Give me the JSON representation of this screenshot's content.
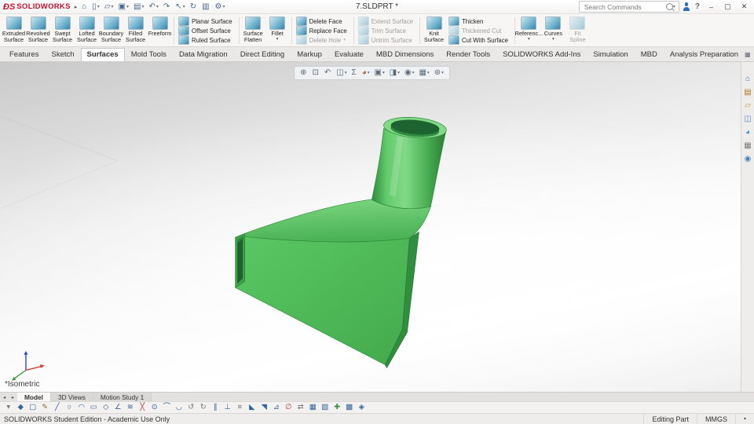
{
  "titlebar": {
    "brand_mark": "ÐS",
    "brand_name": "SOLIDWORKS",
    "flyout_glyph": "▸",
    "title": "7.SLDPRT *",
    "search_placeholder": "Search Commands",
    "help": "?",
    "quick_icons": [
      {
        "name": "home-button",
        "icon": "home-icon",
        "glyph": "⌂",
        "caret": ""
      },
      {
        "name": "new-document-button",
        "icon": "new-document-icon",
        "glyph": "▯",
        "caret": "▾"
      },
      {
        "name": "open-button",
        "icon": "open-folder-icon",
        "glyph": "▱",
        "caret": "▾"
      },
      {
        "name": "save-button",
        "icon": "save-icon",
        "glyph": "▣",
        "caret": "▾"
      },
      {
        "name": "print-button",
        "icon": "print-icon",
        "glyph": "▤",
        "caret": "▾"
      },
      {
        "name": "undo-button",
        "icon": "undo-icon",
        "glyph": "↶",
        "caret": "▾"
      },
      {
        "name": "redo-button",
        "icon": "redo-icon",
        "glyph": "↷",
        "caret": ""
      },
      {
        "name": "select-button",
        "icon": "select-arrow-icon",
        "glyph": "↖",
        "caret": "▾"
      },
      {
        "name": "rebuild-button",
        "icon": "rebuild-icon",
        "glyph": "↻",
        "caret": ""
      },
      {
        "name": "file-properties-button",
        "icon": "file-properties-icon",
        "glyph": "▥",
        "caret": ""
      },
      {
        "name": "options-button",
        "icon": "options-gear-icon",
        "glyph": "⚙",
        "caret": "▾"
      }
    ],
    "window_controls": {
      "minimize": "–",
      "maximize": "▢",
      "close": "✕"
    }
  },
  "ribbon": {
    "big_surface": [
      {
        "name": "extruded-surface-button",
        "icon": "extruded-surface-icon",
        "l1": "Extruded",
        "l2": "Surface",
        "caret": ""
      },
      {
        "name": "revolved-surface-button",
        "icon": "revolved-surface-icon",
        "l1": "Revolved",
        "l2": "Surface",
        "caret": ""
      },
      {
        "name": "swept-surface-button",
        "icon": "swept-surface-icon",
        "l1": "Swept",
        "l2": "Surface",
        "caret": ""
      },
      {
        "name": "lofted-surface-button",
        "icon": "lofted-surface-icon",
        "l1": "Lofted",
        "l2": "Surface",
        "caret": ""
      },
      {
        "name": "boundary-surface-button",
        "icon": "boundary-surface-icon",
        "l1": "Boundary",
        "l2": "Surface",
        "caret": ""
      },
      {
        "name": "filled-surface-button",
        "icon": "filled-surface-icon",
        "l1": "Filled",
        "l2": "Surface",
        "caret": ""
      },
      {
        "name": "freeform-button",
        "icon": "freeform-icon",
        "l1": "Freeform",
        "l2": "",
        "caret": ""
      }
    ],
    "planar_col": [
      {
        "name": "planar-surface-button",
        "icon": "planar-surface-icon",
        "label": "Planar Surface"
      },
      {
        "name": "offset-surface-button",
        "icon": "offset-surface-icon",
        "label": "Offset Surface"
      },
      {
        "name": "ruled-surface-button",
        "icon": "ruled-surface-icon",
        "label": "Ruled Surface"
      }
    ],
    "flatten": {
      "icon": "surface-flatten-icon",
      "l1": "Surface",
      "l2": "Flatten",
      "caret": ""
    },
    "fillet": {
      "icon": "fillet-icon",
      "l1": "Fillet",
      "l2": "",
      "caret": "▾"
    },
    "face_col": [
      {
        "name": "delete-face-button",
        "icon": "delete-face-icon",
        "label": "Delete Face"
      },
      {
        "name": "replace-face-button",
        "icon": "replace-face-icon",
        "label": "Replace Face"
      },
      {
        "name": "delete-hole-button",
        "icon": "delete-hole-icon",
        "label": "Delete Hole",
        "disabled": true,
        "caret": "▾"
      }
    ],
    "trim_col": [
      {
        "name": "extend-surface-button",
        "icon": "extend-surface-icon",
        "label": "Extend Surface",
        "disabled": true
      },
      {
        "name": "trim-surface-button",
        "icon": "trim-surface-icon",
        "label": "Trim Surface",
        "disabled": true
      },
      {
        "name": "untrim-surface-button",
        "icon": "untrim-surface-icon",
        "label": "Untrim Surface",
        "disabled": true
      }
    ],
    "knit": {
      "icon": "knit-surface-icon",
      "l1": "Knit",
      "l2": "Surface",
      "caret": ""
    },
    "thicken_col": [
      {
        "name": "thicken-button",
        "icon": "thicken-icon",
        "label": "Thicken"
      },
      {
        "name": "thickened-cut-button",
        "icon": "thickened-cut-icon",
        "label": "Thickened Cut",
        "disabled": true
      },
      {
        "name": "cut-with-surface-button",
        "icon": "cut-with-surface-icon",
        "label": "Cut With Surface"
      }
    ],
    "right_big": [
      {
        "name": "reference-geometry-button",
        "icon": "reference-geometry-icon",
        "l1": "Referenc...",
        "l2": "",
        "caret": "▾"
      },
      {
        "name": "curves-button",
        "icon": "curves-icon",
        "l1": "Curves",
        "l2": "",
        "caret": "▾"
      },
      {
        "name": "fit-spline-button",
        "icon": "fit-spline-icon",
        "l1": "Fit",
        "l2": "Spline",
        "disabled": true,
        "caret": ""
      }
    ]
  },
  "tabs": [
    {
      "label": "Features",
      "active": false
    },
    {
      "label": "Sketch",
      "active": false
    },
    {
      "label": "Surfaces",
      "active": true
    },
    {
      "label": "Mold Tools",
      "active": false
    },
    {
      "label": "Data Migration",
      "active": false
    },
    {
      "label": "Direct Editing",
      "active": false
    },
    {
      "label": "Markup",
      "active": false
    },
    {
      "label": "Evaluate",
      "active": false
    },
    {
      "label": "MBD Dimensions",
      "active": false
    },
    {
      "label": "Render Tools",
      "active": false
    },
    {
      "label": "SOLIDWORKS Add-Ins",
      "active": false
    },
    {
      "label": "Simulation",
      "active": false
    },
    {
      "label": "MBD",
      "active": false
    },
    {
      "label": "Analysis Preparation",
      "active": false
    }
  ],
  "tab_right_icons": [
    {
      "name": "pane-icon",
      "glyph": "▦"
    },
    {
      "name": "float-pane-icon",
      "glyph": "▢"
    },
    {
      "name": "collapse-ribbon-icon",
      "glyph": "▴"
    }
  ],
  "viewport": {
    "view_label": "*Isometric",
    "hud": [
      {
        "name": "zoom-fit-button",
        "icon": "zoom-fit-icon",
        "g": "⊕",
        "s": "color:#5a6b7a",
        "caret": ""
      },
      {
        "name": "zoom-area-button",
        "icon": "zoom-area-icon",
        "g": "⊡",
        "s": "color:#5a6b7a",
        "caret": ""
      },
      {
        "name": "previous-view-button",
        "icon": "previous-view-icon",
        "g": "↶",
        "s": "color:#5a6b7a",
        "caret": ""
      },
      {
        "name": "section-view-button",
        "icon": "section-view-icon",
        "g": "◫",
        "s": "color:#5a6b7a",
        "caret": "▾"
      },
      {
        "name": "dynamic-annotation-button",
        "icon": "sigma-icon",
        "g": "Σ",
        "s": "color:#5a6b7a",
        "caret": ""
      },
      {
        "name": "appearances-button",
        "icon": "appearance-sphere-icon",
        "g": "◕",
        "s": "color:#c2603a",
        "caret": "▾"
      },
      {
        "name": "view-orientation-button",
        "icon": "view-cube-icon",
        "g": "▣",
        "s": "color:#5a6b7a",
        "caret": "▾"
      },
      {
        "name": "display-style-button",
        "icon": "display-style-icon",
        "g": "◨",
        "s": "color:#5a6b7a",
        "caret": "▾"
      },
      {
        "name": "hide-show-items-button",
        "icon": "eye-icon",
        "g": "◉",
        "s": "color:#5a6b7a",
        "caret": "▾"
      },
      {
        "name": "apply-scene-button",
        "icon": "scene-icon",
        "g": "▦",
        "s": "color:#5a6b7a",
        "caret": "▾"
      },
      {
        "name": "view-settings-button",
        "icon": "view-settings-icon",
        "g": "⊛",
        "s": "color:#5a6b7a",
        "caret": "▾"
      }
    ]
  },
  "taskpane": {
    "icons": [
      {
        "name": "solidworks-resources-icon",
        "g": "⌂",
        "s": "color:#2c6fbb"
      },
      {
        "name": "design-library-icon",
        "g": "▤",
        "s": "color:#b07020"
      },
      {
        "name": "file-explorer-icon",
        "g": "▱",
        "s": "color:#c79c3f"
      },
      {
        "name": "view-palette-icon",
        "g": "◫",
        "s": "color:#5b8bbd"
      },
      {
        "name": "appearances-scenes-icon",
        "g": "◕",
        "s": "color:#3a9ad9"
      },
      {
        "name": "custom-properties-icon",
        "g": "▦",
        "s": "color:#7a7a7a"
      },
      {
        "name": "forum-icon",
        "g": "◉",
        "s": "color:#4a7fbf"
      }
    ]
  },
  "bottom_tabs": {
    "scroll": [
      {
        "name": "tab-scroll-left-icon",
        "g": "◂"
      },
      {
        "name": "tab-scroll-right-icon",
        "g": "▸"
      }
    ],
    "tabs": [
      {
        "label": "Model",
        "active": true
      },
      {
        "label": "3D Views",
        "active": false
      },
      {
        "label": "Motion Study 1",
        "active": false
      }
    ]
  },
  "sketch_toolbar": [
    {
      "g": "▾",
      "s": "color:#777"
    },
    {
      "g": "◆",
      "s": "color:#35639b"
    },
    {
      "g": "▢",
      "s": "color:#35639b"
    },
    {
      "g": "✎",
      "s": "color:#8a6d3b"
    },
    {
      "g": "╱",
      "s": "color:#35639b"
    },
    {
      "g": "○",
      "s": "color:#35639b"
    },
    {
      "g": "◠",
      "s": "color:#35639b"
    },
    {
      "g": "▭",
      "s": "color:#35639b"
    },
    {
      "g": "◇",
      "s": "color:#35639b"
    },
    {
      "g": "∠",
      "s": "color:#35639b"
    },
    {
      "g": "≋",
      "s": "color:#35639b"
    },
    {
      "g": "╳",
      "s": "color:#b3413c"
    },
    {
      "g": "⊙",
      "s": "color:#35639b"
    },
    {
      "g": "⌒",
      "s": "color:#35639b"
    },
    {
      "g": "◡",
      "s": "color:#35639b"
    },
    {
      "g": "↺",
      "s": "color:#777"
    },
    {
      "g": "↻",
      "s": "color:#777"
    },
    {
      "g": "∥",
      "s": "color:#35639b"
    },
    {
      "g": "⊥",
      "s": "color:#35639b"
    },
    {
      "g": "≡",
      "s": "color:#777"
    },
    {
      "g": "◣",
      "s": "color:#35639b"
    },
    {
      "g": "◥",
      "s": "color:#35639b"
    },
    {
      "g": "⊿",
      "s": "color:#35639b"
    },
    {
      "g": "∅",
      "s": "color:#b3413c"
    },
    {
      "g": "⇄",
      "s": "color:#777"
    },
    {
      "g": "▦",
      "s": "color:#35639b"
    },
    {
      "g": "▧",
      "s": "color:#35639b"
    },
    {
      "g": "✚",
      "s": "color:#3f8f46"
    },
    {
      "g": "▩",
      "s": "color:#35639b"
    },
    {
      "g": "◈",
      "s": "color:#35639b"
    }
  ],
  "statusbar": {
    "left": "SOLIDWORKS Student Edition - Academic Use Only",
    "editing": "Editing Part",
    "units": "MMGS",
    "expand_glyph": "▾"
  },
  "colors": {
    "brand_red": "#c8102e",
    "model_green": "#4fbe58",
    "model_mid": "#3fa24a",
    "model_dark": "#2f8f3e",
    "model_hole": "#1d6330",
    "model_light": "#82da87"
  }
}
